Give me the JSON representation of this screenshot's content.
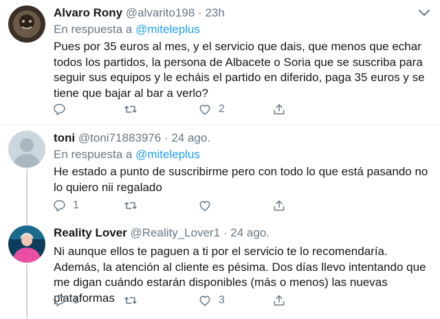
{
  "tweets": [
    {
      "name": "Alvaro Rony",
      "handle": "@alvarito198",
      "separator": "·",
      "time": "23h",
      "reply_prefix": "En respuesta a",
      "reply_mention": "@miteleplus",
      "text": "Pues por 35 euros al mes, y el servicio que dais, que menos que echar todos los partidos, la persona de Albacete o Soria que se suscriba para seguir sus equipos y le echáis el partido en diferido, paga 35 euros y se tiene que bajar al bar a verlo?",
      "reply_count": "",
      "retweet_count": "",
      "like_count": "2",
      "avatar": "photo-dark"
    },
    {
      "name": "toni",
      "handle": "@toni71883976",
      "separator": "·",
      "time": "24 ago.",
      "reply_prefix": "En respuesta a",
      "reply_mention": "@miteleplus",
      "text": "He estado a punto de suscribirme  pero con todo lo que está pasando no lo quiero nii regalado",
      "reply_count": "1",
      "retweet_count": "",
      "like_count": "",
      "avatar": "default-profile"
    },
    {
      "name": "Reality Lover",
      "handle": "@Reality_Lover1",
      "separator": "·",
      "time": "24 ago.",
      "text": "Ni aunque ellos te paguen a ti por el servicio te lo recomendaría. Además, la atención al cliente es pésima. Dos días llevo intentando que me digan cuándo estarán disponibles (más o menos) las nuevas plataformas",
      "reply_count": "1",
      "retweet_count": "",
      "like_count": "3",
      "avatar": "photo-pink"
    }
  ],
  "icons": {
    "reply": "reply-icon",
    "retweet": "retweet-icon",
    "like": "like-icon",
    "share": "share-icon",
    "more": "chevron-down-icon"
  },
  "colors": {
    "link": "#1da1f2",
    "secondary_text": "#657786",
    "divider": "#e6ecf0",
    "thread_line": "#ccd6dd"
  }
}
